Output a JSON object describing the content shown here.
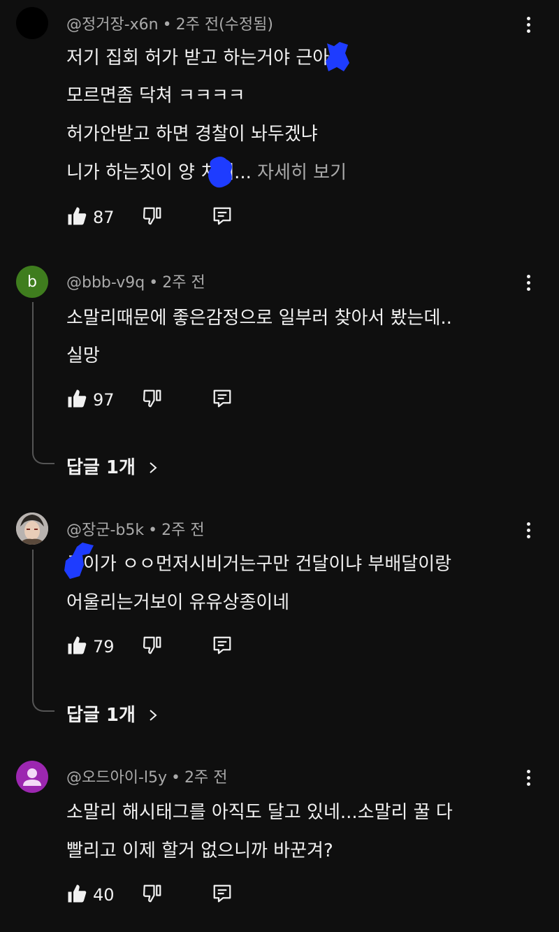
{
  "comments": [
    {
      "author": "@정거장-x6n",
      "time": "2주 전(수정됨)",
      "lines": [
        "저기 집회 허가 받고  하는거야  근아",
        "모르면좀 닥쳐 ㅋㅋㅋㅋ",
        "허가안받고 하면 경찰이 놔두겠냐",
        "니가 하는짓이 양  치네..."
      ],
      "read_more": "자세히 보기",
      "likes": "87"
    },
    {
      "avatar_letter": "b",
      "author": "@bbb-v9q",
      "time": "2주 전",
      "lines": [
        "소말리때문에 좋은감정으로 일부러 찾아서 봤는데..",
        "실망"
      ],
      "likes": "97",
      "replies": "답글 1개"
    },
    {
      "author": "@장군-b5k",
      "time": "2주 전",
      "lines": [
        "  근이가 ㅇㅇ먼저시비거는구만 건달이냐 부배달이랑",
        "어울리는거보이 유유상종이네"
      ],
      "likes": "79",
      "replies": "답글 1개"
    },
    {
      "author": "@오드아이-l5y",
      "time": "2주 전",
      "lines": [
        "소말리 해시태그를 아직도 달고 있네...소말리 꿀 다",
        "빨리고 이제 할거 없으니까 바꾼겨?"
      ],
      "likes": "40"
    }
  ],
  "colors": {
    "background": "#0f0f0f",
    "text": "#f1f1f1",
    "muted": "#aaaaaa",
    "censor_blot": "#1e3cff"
  },
  "icons": [
    "thumbs-up-icon",
    "thumbs-down-icon",
    "reply-comment-icon",
    "more-vert-icon",
    "chevron-right-icon"
  ]
}
